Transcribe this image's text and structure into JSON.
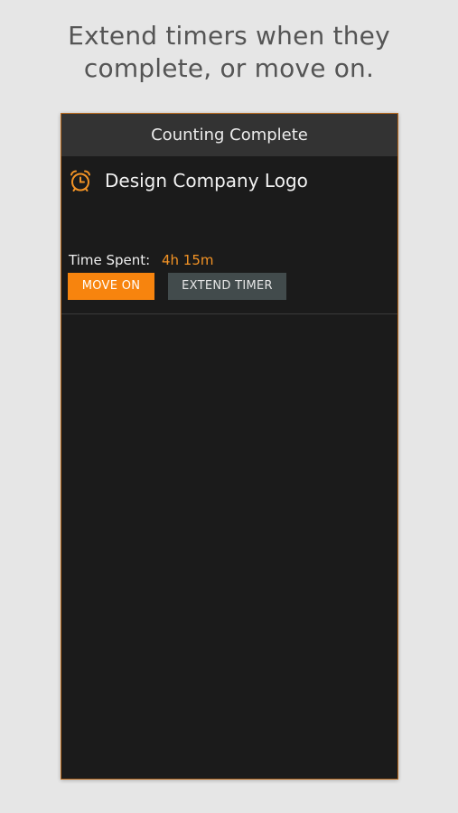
{
  "promo": {
    "line1": "Extend timers when they",
    "line2": "complete, or move on."
  },
  "screen": {
    "title": "Counting Complete",
    "task": {
      "icon": "alarm-clock-icon",
      "name": "Design Company Logo",
      "time_label": "Time Spent:",
      "time_value": "4h 15m"
    },
    "actions": {
      "move_on_label": "MOVE ON",
      "extend_label": "EXTEND TIMER"
    }
  },
  "colors": {
    "accent": "#f7840e",
    "time_value": "#f39325",
    "screen_bg": "#1b1b1b",
    "titlebar_bg": "#333333",
    "secondary_button": "#424b4c",
    "page_bg": "#e6e6e6"
  }
}
